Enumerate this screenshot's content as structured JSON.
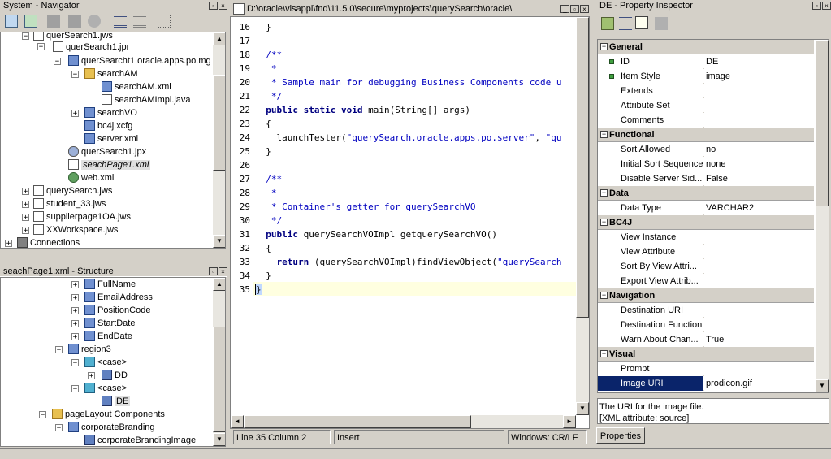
{
  "navigator": {
    "title": "System - Navigator",
    "items": [
      {
        "label": "querSearch1.jws"
      },
      {
        "label": "querSearch1.jpr"
      },
      {
        "label": "querSearcht1.oracle.apps.po.mg"
      },
      {
        "label": "searchAM"
      },
      {
        "label": "searchAM.xml"
      },
      {
        "label": "searchAMImpl.java"
      },
      {
        "label": "searchVO"
      },
      {
        "label": "bc4j.xcfg"
      },
      {
        "label": "server.xml"
      },
      {
        "label": "querSearch1.jpx"
      },
      {
        "label": "seachPage1.xml"
      },
      {
        "label": "web.xml"
      },
      {
        "label": "querySearch.jws"
      },
      {
        "label": "student_33.jws"
      },
      {
        "label": "supplierpage1OA.jws"
      },
      {
        "label": "XXWorkspace.jws"
      },
      {
        "label": "Connections"
      }
    ]
  },
  "structure": {
    "title": "seachPage1.xml - Structure",
    "items": [
      {
        "label": "FullName"
      },
      {
        "label": "EmailAddress"
      },
      {
        "label": "PositionCode"
      },
      {
        "label": "StartDate"
      },
      {
        "label": "EndDate"
      },
      {
        "label": "region3"
      },
      {
        "label": "<case>"
      },
      {
        "label": "DD"
      },
      {
        "label": "<case>"
      },
      {
        "label": "DE"
      },
      {
        "label": "pageLayout Components"
      },
      {
        "label": "corporateBranding"
      },
      {
        "label": "corporateBrandingImage"
      }
    ]
  },
  "editor": {
    "title": "D:\\oracle\\visappl\\fnd\\11.5.0\\secure\\myprojects\\querySearch\\oracle\\",
    "lines": [
      {
        "n": "16",
        "text": "  }"
      },
      {
        "n": "17",
        "text": ""
      },
      {
        "n": "18",
        "text": "  /**"
      },
      {
        "n": "19",
        "text": "   *"
      },
      {
        "n": "20",
        "text": "   * Sample main for debugging Business Components code u"
      },
      {
        "n": "21",
        "text": "   */"
      },
      {
        "n": "22",
        "text": "  public static void main(String[] args)"
      },
      {
        "n": "23",
        "text": "  {"
      },
      {
        "n": "24",
        "text": "    launchTester(\"querySearch.oracle.apps.po.server\", \"qu"
      },
      {
        "n": "25",
        "text": "  }"
      },
      {
        "n": "26",
        "text": ""
      },
      {
        "n": "27",
        "text": "  /**"
      },
      {
        "n": "28",
        "text": "   *"
      },
      {
        "n": "29",
        "text": "   * Container's getter for querySearchVO"
      },
      {
        "n": "30",
        "text": "   */"
      },
      {
        "n": "31",
        "text": "  public querySearchVOImpl getquerySearchVO()"
      },
      {
        "n": "32",
        "text": "  {"
      },
      {
        "n": "33",
        "text": "    return (querySearchVOImpl)findViewObject(\"querySearch"
      },
      {
        "n": "34",
        "text": "  }"
      },
      {
        "n": "35",
        "text": "}"
      }
    ],
    "status": {
      "position": "Line 35 Column 2",
      "mode": "Insert",
      "eol": "Windows: CR/LF"
    }
  },
  "inspector": {
    "title": "DE - Property Inspector",
    "rows": [
      {
        "type": "cat",
        "name": "General"
      },
      {
        "type": "prop",
        "name": "ID",
        "value": "DE",
        "req": true
      },
      {
        "type": "prop",
        "name": "Item Style",
        "value": "image",
        "req": true
      },
      {
        "type": "prop",
        "name": "Extends",
        "value": ""
      },
      {
        "type": "prop",
        "name": "Attribute Set",
        "value": ""
      },
      {
        "type": "prop",
        "name": "Comments",
        "value": ""
      },
      {
        "type": "cat",
        "name": "Functional"
      },
      {
        "type": "prop",
        "name": "Sort Allowed",
        "value": "no"
      },
      {
        "type": "prop",
        "name": "Initial Sort Sequence",
        "value": "none"
      },
      {
        "type": "prop",
        "name": "Disable Server Sid...",
        "value": "False"
      },
      {
        "type": "cat",
        "name": "Data"
      },
      {
        "type": "prop",
        "name": "Data Type",
        "value": "VARCHAR2"
      },
      {
        "type": "cat",
        "name": "BC4J"
      },
      {
        "type": "prop",
        "name": "View Instance",
        "value": ""
      },
      {
        "type": "prop",
        "name": "View Attribute",
        "value": ""
      },
      {
        "type": "prop",
        "name": "Sort By View Attri...",
        "value": ""
      },
      {
        "type": "prop",
        "name": "Export View Attrib...",
        "value": ""
      },
      {
        "type": "cat",
        "name": "Navigation"
      },
      {
        "type": "prop",
        "name": "Destination URI",
        "value": ""
      },
      {
        "type": "prop",
        "name": "Destination Function",
        "value": ""
      },
      {
        "type": "prop",
        "name": "Warn About Chan...",
        "value": "True"
      },
      {
        "type": "cat",
        "name": "Visual"
      },
      {
        "type": "prop",
        "name": "Prompt",
        "value": ""
      },
      {
        "type": "prop",
        "name": "Image URI",
        "value": "prodicon.gif",
        "selected": true
      }
    ],
    "description": "The URI for the image file.",
    "description2": "[XML attribute: source]",
    "tab": "Properties"
  },
  "colors": {
    "selection": "#0a246a",
    "current_line": "#ffffe0",
    "comment": "#0000c0",
    "keyword": "#000080"
  }
}
